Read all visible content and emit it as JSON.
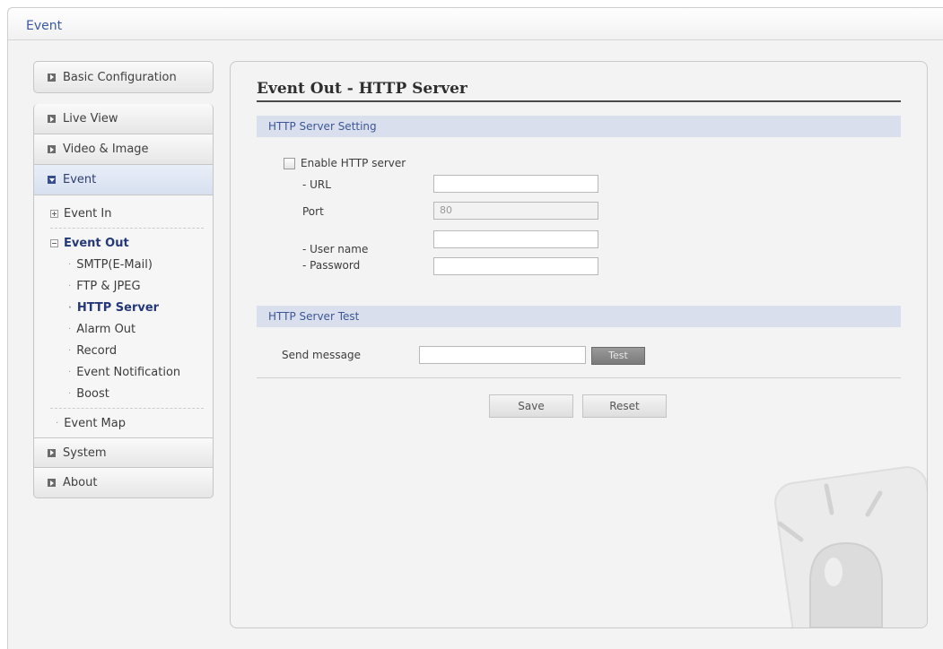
{
  "header": {
    "title": "Event"
  },
  "sidebar": {
    "basic_configuration": "Basic Configuration",
    "items": [
      {
        "label": "Live View"
      },
      {
        "label": "Video & Image"
      },
      {
        "label": "Event"
      }
    ],
    "event_sub": {
      "event_in": "Event In",
      "event_out": "Event Out",
      "event_out_items": [
        {
          "label": "SMTP(E-Mail)"
        },
        {
          "label": "FTP & JPEG"
        },
        {
          "label": "HTTP Server"
        },
        {
          "label": "Alarm Out"
        },
        {
          "label": "Record"
        },
        {
          "label": "Event Notification"
        },
        {
          "label": "Boost"
        }
      ],
      "event_map": "Event Map"
    },
    "bottom_items": [
      {
        "label": "System"
      },
      {
        "label": "About"
      }
    ]
  },
  "main": {
    "title": "Event Out - HTTP Server",
    "setting_section": {
      "heading": "HTTP Server Setting",
      "enable_label": "Enable HTTP server",
      "enabled": false,
      "url_label": "- URL",
      "url_value": "",
      "port_label": "Port",
      "port_value": "80",
      "username_label": "- User name",
      "username_value": "",
      "password_label": "- Password",
      "password_value": ""
    },
    "test_section": {
      "heading": "HTTP Server Test",
      "send_message_label": "Send message",
      "send_message_value": "",
      "test_button": "Test"
    },
    "save_button": "Save",
    "reset_button": "Reset"
  },
  "colors": {
    "accent": "#3a58a4",
    "section_header_bg": "#d9dfec",
    "active_nav_bg": "#d7e0f0"
  }
}
